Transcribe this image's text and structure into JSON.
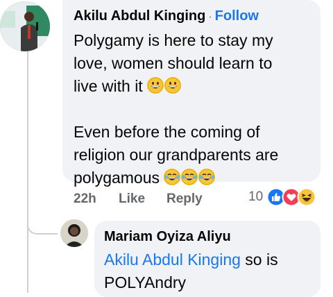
{
  "comment": {
    "author": "Akilu Abdul Kinging",
    "separator": "·",
    "follow_label": "Follow",
    "para1_line1": "Polygamy is here to stay my",
    "para1_line2": "love, women should learn to",
    "para1_line3": "live with it",
    "para1_emojis": [
      "grinning-face-emoji",
      "grinning-face-emoji"
    ],
    "para2_line1": "Even before the coming of",
    "para2_line2": "religion our grandparents are",
    "para2_line3": "polygamous",
    "para2_emojis": [
      "tears-of-joy-emoji",
      "tears-of-joy-emoji",
      "tears-of-joy-emoji"
    ],
    "time": "22h",
    "like_label": "Like",
    "reply_label": "Reply",
    "reaction_count": "10",
    "reactions": [
      "like-reaction-icon",
      "love-reaction-icon",
      "haha-reaction-icon"
    ],
    "colors": {
      "like": "#1877f2",
      "love": "#f33e58",
      "haha": "#f7c53a"
    }
  },
  "reply": {
    "author": "Mariam Oyiza Aliyu",
    "mention": "Akilu Abdul Kinging",
    "text_line1_rest": " so is",
    "text_line2": "POLYAndry"
  }
}
